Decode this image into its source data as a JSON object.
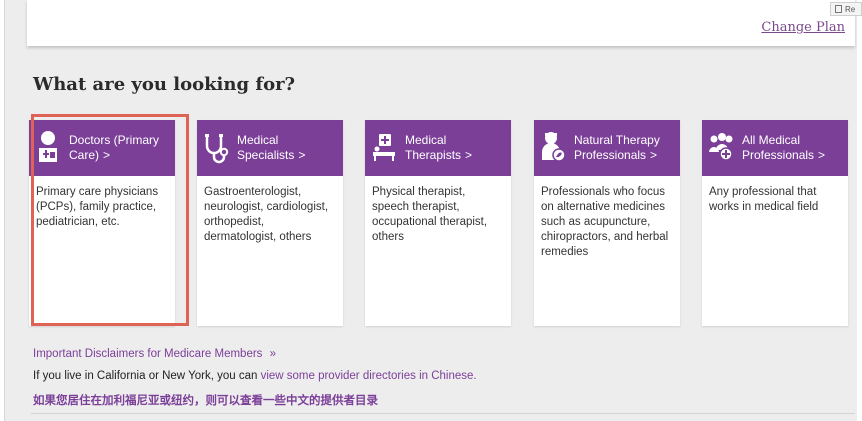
{
  "plan": {
    "change_plan_label": "Change Plan"
  },
  "reader_tab": {
    "label": "Re",
    "icon": "document-icon"
  },
  "section": {
    "heading": "What are you looking for?"
  },
  "cards": [
    {
      "icon": "doctor-icon",
      "title_line1": "Doctors (Primary",
      "title_line2": "Care)",
      "chevron": ">",
      "description": "Primary care physicians (PCPs), family practice, pediatrician, etc.",
      "selected": true
    },
    {
      "icon": "stethoscope-icon",
      "title_line1": "Medical",
      "title_line2": "Specialists",
      "chevron": ">",
      "description": "Gastroenterologist, neurologist, cardiologist, orthopedist, dermatologist, others",
      "selected": false
    },
    {
      "icon": "therapy-bed-icon",
      "title_line1": "Medical",
      "title_line2": "Therapists",
      "chevron": ">",
      "description": "Physical therapist, speech therapist, occupational therapist, others",
      "selected": false
    },
    {
      "icon": "natural-therapist-icon",
      "title_line1": "Natural Therapy",
      "title_line2": "Professionals",
      "chevron": ">",
      "description": "Professionals who focus on alternative medicines such as acupuncture, chiropractors, and herbal remedies",
      "selected": false
    },
    {
      "icon": "all-professionals-icon",
      "title_line1": "All Medical",
      "title_line2": "Professionals",
      "chevron": ">",
      "description": "Any professional that works in medical field",
      "selected": false
    }
  ],
  "footer": {
    "disclaimers_label": "Important Disclaimers for Medicare Members",
    "disclaimers_arrow": "»",
    "ca_ny_prefix": "If you live in California or New York, you can ",
    "ca_ny_link": "view some provider directories in Chinese.",
    "chinese_link": "如果您居住在加利福尼亚或纽约，则可以查看一些中文的提供者目录"
  },
  "colors": {
    "brand_purple": "#7b3f98",
    "selection_outline": "#e06155",
    "page_background": "#ededee"
  }
}
